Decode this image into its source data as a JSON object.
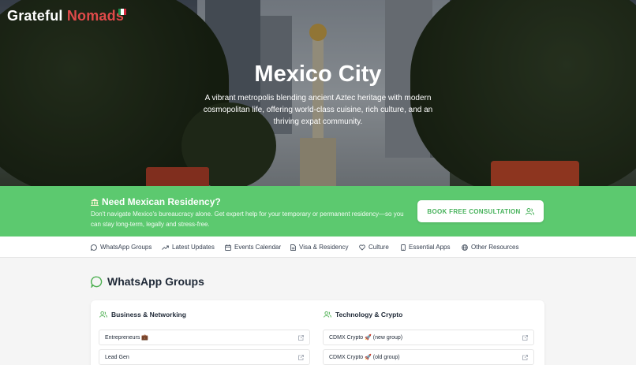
{
  "brand": {
    "name_main": "Grateful ",
    "name_accent": "Nomads",
    "accent_color": "#e04a4a"
  },
  "hero": {
    "title": "Mexico City",
    "subtitle": "A vibrant metropolis blending ancient Aztec heritage with modern cosmopolitan life, offering world-class cuisine, rich culture, and an thriving expat community."
  },
  "banner": {
    "title": "Need Mexican Residency?",
    "text": "Don't navigate Mexico's bureaucracy alone. Get expert help for your temporary or permanent residency—so you can stay long-term, legally and stress-free.",
    "cta_label": "BOOK FREE CONSULTATION",
    "bg_color": "#5cc96f"
  },
  "nav": {
    "items": [
      {
        "label": "WhatsApp Groups",
        "icon": "chat-icon"
      },
      {
        "label": "Latest Updates",
        "icon": "trending-icon"
      },
      {
        "label": "Events Calendar",
        "icon": "calendar-icon"
      },
      {
        "label": "Visa & Residency",
        "icon": "document-icon"
      },
      {
        "label": "Culture",
        "icon": "heart-icon"
      },
      {
        "label": "Essential Apps",
        "icon": "phone-icon"
      },
      {
        "label": "Other Resources",
        "icon": "globe-icon"
      }
    ]
  },
  "whatsapp": {
    "title": "WhatsApp Groups",
    "columns": [
      {
        "title": "Business & Networking",
        "links": [
          "Entrepreneurs 💼",
          "Lead Gen"
        ]
      },
      {
        "title": "Technology & Crypto",
        "links": [
          "CDMX Crypto 🚀 (new group)",
          "CDMX Crypto 🚀 (old group)"
        ]
      }
    ]
  }
}
